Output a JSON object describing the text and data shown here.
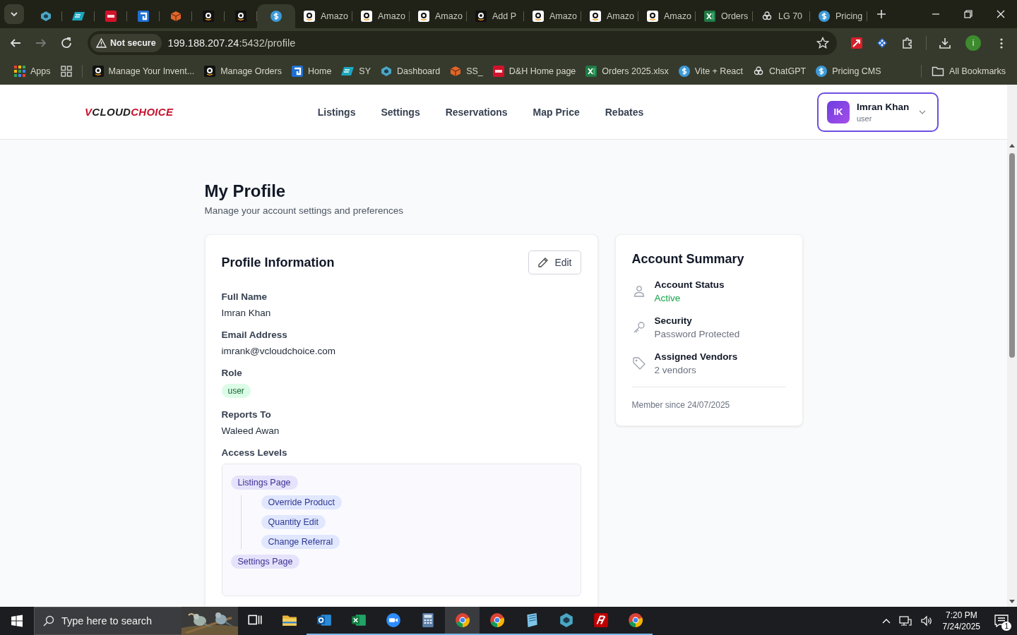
{
  "browser": {
    "tabs": [
      {
        "kind": "diamond",
        "selected": false
      },
      {
        "kind": "ec",
        "selected": false
      },
      {
        "kind": "dh",
        "selected": false
      },
      {
        "kind": "g",
        "selected": false
      },
      {
        "kind": "ss",
        "selected": false
      },
      {
        "kind": "amazon-dark",
        "selected": false
      },
      {
        "kind": "amazon-dark",
        "selected": false
      },
      {
        "kind": "dollar",
        "selected": true
      },
      {
        "kind": "amazon",
        "title": "Amazo",
        "selected": false
      },
      {
        "kind": "amazon",
        "title": "Amazo",
        "selected": false
      },
      {
        "kind": "amazon",
        "title": "Amazo",
        "selected": false
      },
      {
        "kind": "amazon-dark",
        "title": "Add P",
        "selected": false
      },
      {
        "kind": "amazon",
        "title": "Amazo",
        "selected": false
      },
      {
        "kind": "amazon",
        "title": "Amazo",
        "selected": false
      },
      {
        "kind": "amazon",
        "title": "Amazo",
        "selected": false
      },
      {
        "kind": "excel",
        "title": "Orders",
        "selected": false
      },
      {
        "kind": "chatgpt",
        "title": "LG 70",
        "selected": false
      },
      {
        "kind": "dollar",
        "title": "Pricing",
        "selected": false
      }
    ],
    "back": {
      "disabled": false
    },
    "forward": {
      "disabled": true
    },
    "security": "Not secure",
    "url_host": "199.188.207.24",
    "url_path": ":5432/profile",
    "profile_initial": "i",
    "bookmarks": [
      {
        "kind": "apps",
        "title": "Apps"
      },
      {
        "kind": "grid"
      },
      {
        "kind": "amazon-dark",
        "title": "Manage Your Invent..."
      },
      {
        "kind": "amazon-dark",
        "title": "Manage Orders"
      },
      {
        "kind": "g",
        "title": "Home"
      },
      {
        "kind": "ec",
        "title": "SY"
      },
      {
        "kind": "diamond",
        "title": "Dashboard"
      },
      {
        "kind": "ss",
        "title": "SS_"
      },
      {
        "kind": "dh",
        "title": "D&H Home page"
      },
      {
        "kind": "excel",
        "title": "Orders 2025.xlsx"
      },
      {
        "kind": "dollar",
        "title": "Vite + React"
      },
      {
        "kind": "chatgpt",
        "title": "ChatGPT"
      },
      {
        "kind": "dollar",
        "title": "Pricing CMS"
      }
    ],
    "all_bookmarks": "All Bookmarks"
  },
  "app": {
    "logo": [
      {
        "text": "V",
        "accent": true
      },
      {
        "text": "CLOUD",
        "accent": false
      },
      {
        "text": "CHOICE",
        "accent": true
      }
    ],
    "nav": [
      {
        "label": "Listings"
      },
      {
        "label": "Settings"
      },
      {
        "label": "Reservations"
      },
      {
        "label": "Map Price"
      },
      {
        "label": "Rebates"
      }
    ],
    "user": {
      "initials": "IK",
      "name": "Imran Khan",
      "role": "user"
    }
  },
  "page": {
    "title": "My Profile",
    "subtitle": "Manage your account settings and preferences"
  },
  "profile": {
    "title": "Profile Information",
    "edit": "Edit",
    "fields": [
      {
        "kind": "text",
        "label": "Full Name",
        "value": "Imran Khan"
      },
      {
        "kind": "text",
        "label": "Email Address",
        "value": "imrank@vcloudchoice.com"
      },
      {
        "kind": "badge",
        "label": "Role",
        "value": "user"
      },
      {
        "kind": "text",
        "label": "Reports To",
        "value": "Waleed Awan"
      },
      {
        "kind": "tree",
        "label": "Access Levels",
        "items": [
          {
            "label": "Listings Page",
            "children": [
              {
                "label": "Override Product"
              },
              {
                "label": "Quantity Edit"
              },
              {
                "label": "Change Referral"
              }
            ]
          },
          {
            "label": "Settings Page"
          }
        ]
      }
    ]
  },
  "summary": {
    "title": "Account Summary",
    "items": [
      {
        "kind": "person",
        "label": "Account Status",
        "value": "Active",
        "color": "#16a34a"
      },
      {
        "kind": "key",
        "label": "Security",
        "value": "Password Protected",
        "color": "#6b7280"
      },
      {
        "kind": "tag",
        "label": "Assigned Vendors",
        "value": "2 vendors",
        "color": "#6b7280"
      }
    ],
    "footer": "Member since 24/07/2025"
  },
  "taskbar": {
    "search_placeholder": "Type here to search",
    "apps": [
      {
        "kind": "taskview",
        "running": false,
        "selected": false
      },
      {
        "kind": "explorer",
        "running": false,
        "selected": false
      },
      {
        "kind": "outlook",
        "running": true,
        "selected": false
      },
      {
        "kind": "excel",
        "running": true,
        "selected": false
      },
      {
        "kind": "zoom",
        "running": true,
        "selected": false
      },
      {
        "kind": "calculator",
        "running": true,
        "selected": false
      },
      {
        "kind": "chrome",
        "running": true,
        "selected": true
      },
      {
        "kind": "chrome",
        "running": true,
        "selected": false
      },
      {
        "kind": "notepad",
        "running": true,
        "selected": false
      },
      {
        "kind": "diamond",
        "running": true,
        "selected": false
      },
      {
        "kind": "filezilla",
        "running": true,
        "selected": false
      },
      {
        "kind": "chrome",
        "running": true,
        "selected": false
      }
    ],
    "time": "7:20 PM",
    "date": "7/24/2025",
    "notifications": "1"
  }
}
